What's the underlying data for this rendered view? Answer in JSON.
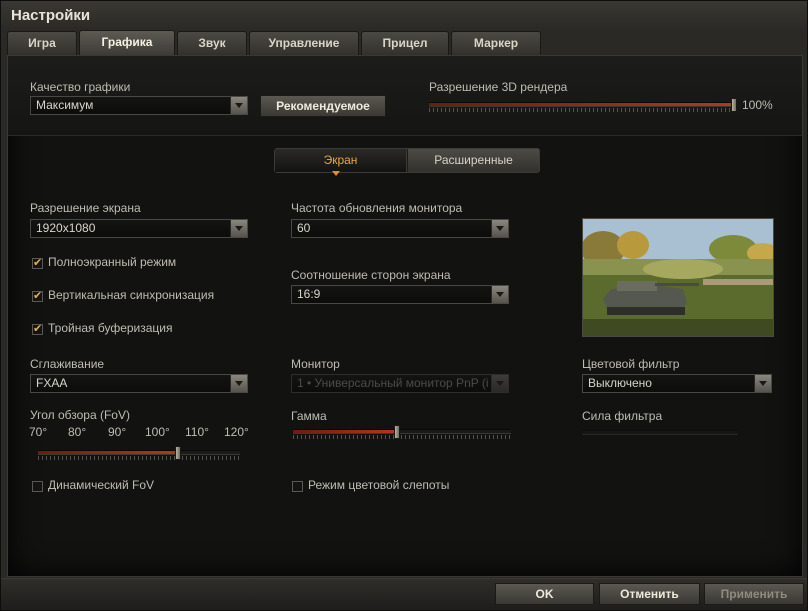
{
  "window": {
    "title": "Настройки"
  },
  "tabs": [
    {
      "label": "Игра"
    },
    {
      "label": "Графика",
      "active": true
    },
    {
      "label": "Звук"
    },
    {
      "label": "Управление"
    },
    {
      "label": "Прицел"
    },
    {
      "label": "Маркер"
    }
  ],
  "quality": {
    "label": "Качество графики",
    "value": "Максимум",
    "recommended_label": "Рекомендуемое"
  },
  "render_resolution": {
    "label": "Разрешение 3D рендера",
    "value_text": "100%",
    "fraction": 1.0
  },
  "subtabs": [
    {
      "label": "Экран",
      "active": true
    },
    {
      "label": "Расширенные"
    }
  ],
  "screen": {
    "resolution": {
      "label": "Разрешение экрана",
      "value": "1920x1080"
    },
    "refresh": {
      "label": "Частота обновления монитора",
      "value": "60"
    },
    "aspect": {
      "label": "Соотношение сторон экрана",
      "value": "16:9"
    },
    "fullscreen": {
      "label": "Полноэкранный режим",
      "checked": true
    },
    "vsync": {
      "label": "Вертикальная синхронизация",
      "checked": true
    },
    "triple_buffer": {
      "label": "Тройная буферизация",
      "checked": true
    },
    "antialiasing": {
      "label": "Сглаживание",
      "value": "FXAA"
    },
    "monitor": {
      "label": "Монитор",
      "value": "1 • Универсальный монитор PnP (i",
      "disabled": true
    },
    "color_filter": {
      "label": "Цветовой фильтр",
      "value": "Выключено"
    },
    "filter_strength": {
      "label": "Сила фильтра",
      "fraction": 0.0
    },
    "fov": {
      "label": "Угол обзора (FoV)",
      "ticks": [
        "70°",
        "80°",
        "90°",
        "100°",
        "110°",
        "120°"
      ],
      "fraction": 0.71
    },
    "gamma": {
      "label": "Гамма",
      "fraction": 0.49
    },
    "dynamic_fov": {
      "label": "Динамический FoV",
      "checked": false
    },
    "colorblind": {
      "label": "Режим цветовой слепоты",
      "checked": false
    }
  },
  "footer": {
    "ok_label": "OK",
    "cancel_label": "Отменить",
    "apply_label": "Применить"
  },
  "colors": {
    "accent_orange": "#e8a645",
    "slider_red": "#b23a1e",
    "panel_bg": "#121211"
  }
}
